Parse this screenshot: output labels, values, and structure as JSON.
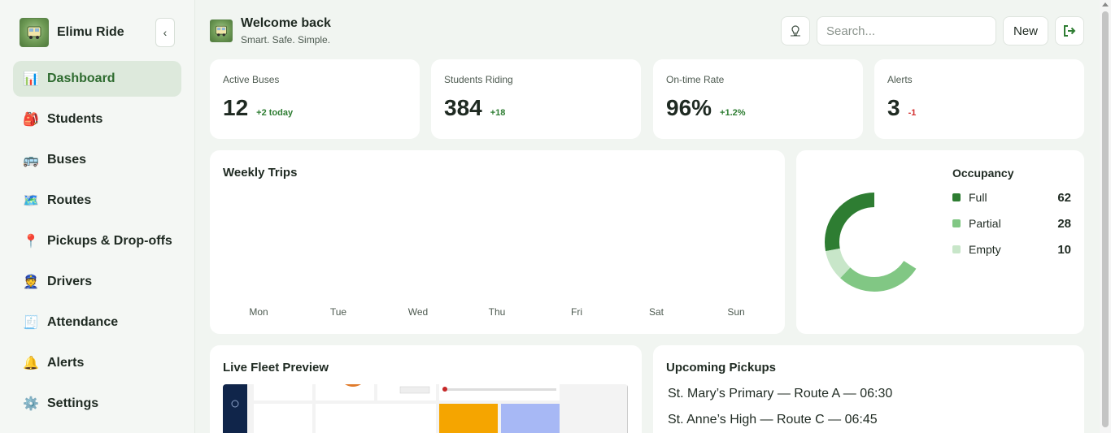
{
  "brand": {
    "name": "Elimu Ride",
    "logo_icon": "school-bus-logo"
  },
  "sidebar": {
    "collapse_label": "‹",
    "items": [
      {
        "label": "Dashboard",
        "icon": "📊",
        "active": true
      },
      {
        "label": "Students",
        "icon": "🎒"
      },
      {
        "label": "Buses",
        "icon": "🚌"
      },
      {
        "label": "Routes",
        "icon": "🗺️"
      },
      {
        "label": "Pickups & Drop-offs",
        "icon": "📍"
      },
      {
        "label": "Drivers",
        "icon": "👮"
      },
      {
        "label": "Attendance",
        "icon": "🧾"
      },
      {
        "label": "Alerts",
        "icon": "🔔"
      },
      {
        "label": "Settings",
        "icon": "⚙️"
      }
    ]
  },
  "header": {
    "title": "Welcome back",
    "subtitle": "Smart. Safe. Simple.",
    "search_placeholder": "Search...",
    "new_label": "New"
  },
  "stats": [
    {
      "label": "Active Buses",
      "value": "12",
      "delta": "+2 today",
      "trend": "up"
    },
    {
      "label": "Students Riding",
      "value": "384",
      "delta": "+18",
      "trend": "up"
    },
    {
      "label": "On-time Rate",
      "value": "96%",
      "delta": "+1.2%",
      "trend": "up"
    },
    {
      "label": "Alerts",
      "value": "3",
      "delta": "-1",
      "trend": "down"
    }
  ],
  "weekly_trips": {
    "title": "Weekly Trips",
    "days": [
      "Mon",
      "Tue",
      "Wed",
      "Thu",
      "Fri",
      "Sat",
      "Sun"
    ]
  },
  "occupancy": {
    "title": "Occupancy",
    "colors": {
      "full": "#2e7d32",
      "partial": "#81c784",
      "empty": "#c8e6c9"
    }
  },
  "chart_data": {
    "type": "pie",
    "title": "Occupancy",
    "categories": [
      "Full",
      "Partial",
      "Empty"
    ],
    "values": [
      62,
      28,
      10
    ]
  },
  "live_fleet": {
    "title": "Live Fleet Preview"
  },
  "upcoming": {
    "title": "Upcoming Pickups",
    "items": [
      "St. Mary’s Primary — Route A — 06:30",
      "St. Anne’s High — Route C — 06:45"
    ]
  }
}
